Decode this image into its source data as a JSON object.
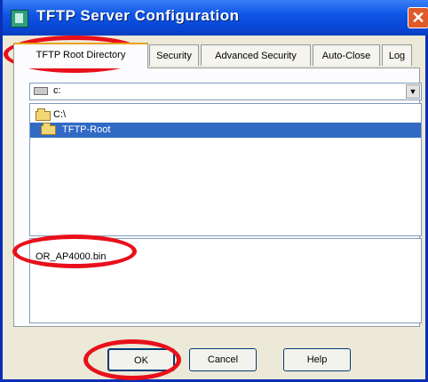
{
  "window": {
    "title": "TFTP Server Configuration"
  },
  "tabs": [
    {
      "label": "TFTP Root Directory"
    },
    {
      "label": "Security"
    },
    {
      "label": "Advanced Security"
    },
    {
      "label": "Auto-Close"
    },
    {
      "label": "Log"
    }
  ],
  "drive": {
    "label": "c:"
  },
  "directories": [
    {
      "label": "C:\\"
    },
    {
      "label": "TFTP-Root"
    }
  ],
  "files": [
    {
      "label": "OR_AP4000.bin"
    }
  ],
  "buttons": {
    "ok": "OK",
    "cancel": "Cancel",
    "help": "Help"
  },
  "colors": {
    "annotation": "#e8101b",
    "selection": "#316ac5",
    "titlebar": "#0746d3"
  }
}
